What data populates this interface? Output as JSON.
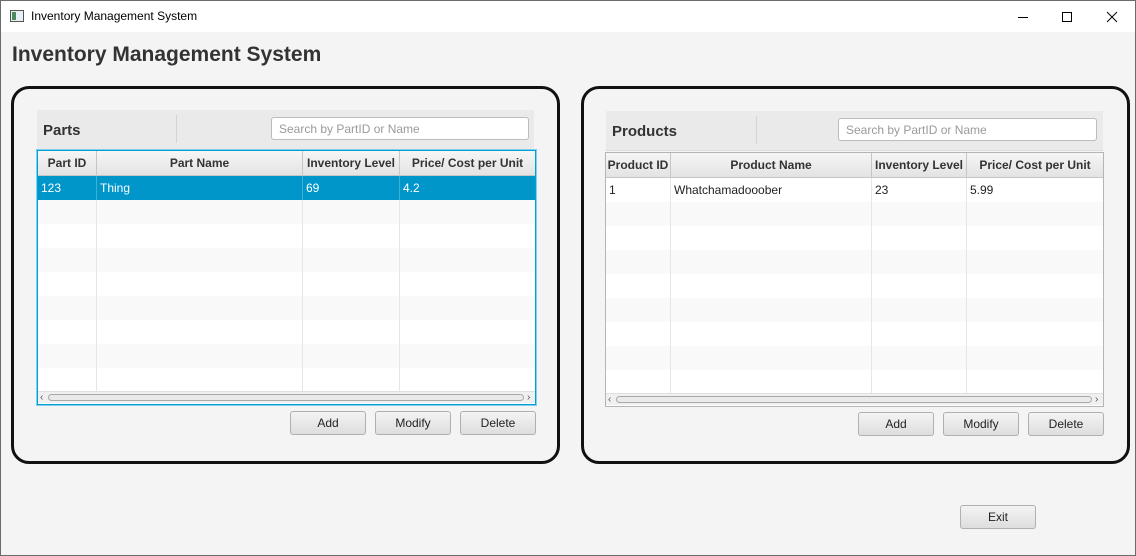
{
  "window": {
    "title": "Inventory Management System"
  },
  "heading": "Inventory Management System",
  "parts": {
    "title": "Parts",
    "search_placeholder": "Search by PartID or Name",
    "columns": [
      "Part ID",
      "Part Name",
      "Inventory Level",
      "Price/ Cost per Unit"
    ],
    "rows": [
      [
        "123",
        "Thing",
        "69",
        "4.2"
      ]
    ],
    "selected_row": 0,
    "buttons": {
      "add": "Add",
      "modify": "Modify",
      "delete": "Delete"
    }
  },
  "products": {
    "title": "Products",
    "search_placeholder": "Search by PartID or Name",
    "columns": [
      "Product ID",
      "Product Name",
      "Inventory Level",
      "Price/ Cost per Unit"
    ],
    "rows": [
      [
        "1",
        "Whatchamadooober",
        "23",
        "5.99"
      ]
    ],
    "buttons": {
      "add": "Add",
      "modify": "Modify",
      "delete": "Delete"
    }
  },
  "exit_label": "Exit",
  "colors": {
    "selection": "#0096c9",
    "focus": "#039ed3",
    "panel_border": "#111111"
  },
  "icons": {
    "app": "app-window-icon",
    "minimize": "minimize-icon",
    "maximize": "maximize-icon",
    "close": "close-icon"
  }
}
